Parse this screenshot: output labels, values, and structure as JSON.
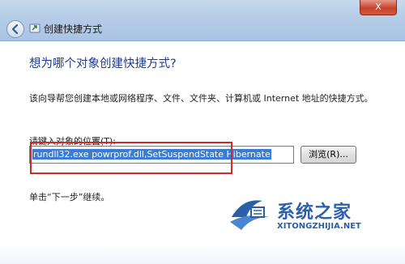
{
  "window": {
    "title": "创建快捷方式",
    "close_label": "X",
    "colors": {
      "titlebar": "#b5cce6",
      "close": "#c8422b",
      "heading": "#1f3a93",
      "highlight": "#d12a2a",
      "selection": "#3a7bd5"
    }
  },
  "main": {
    "heading": "想为哪个对象创建快捷方式?",
    "description": "该向导帮您创建本地或网络程序、文件、文件夹、计算机或 Internet 地址的快捷方式。",
    "location_label": "请键入对象的位置(T):",
    "location_value": "rundll32.exe powrprof.dll,SetSuspendState Hibernate",
    "browse_label": "浏览(R)...",
    "hint": "单击“下一步”继续。"
  },
  "watermark": {
    "name_cn": "系统之家",
    "name_en": "XITONGZHIJIA.NET"
  },
  "icons": [
    "back-arrow-icon",
    "shortcut-wizard-icon",
    "watermark-logo-icon"
  ]
}
